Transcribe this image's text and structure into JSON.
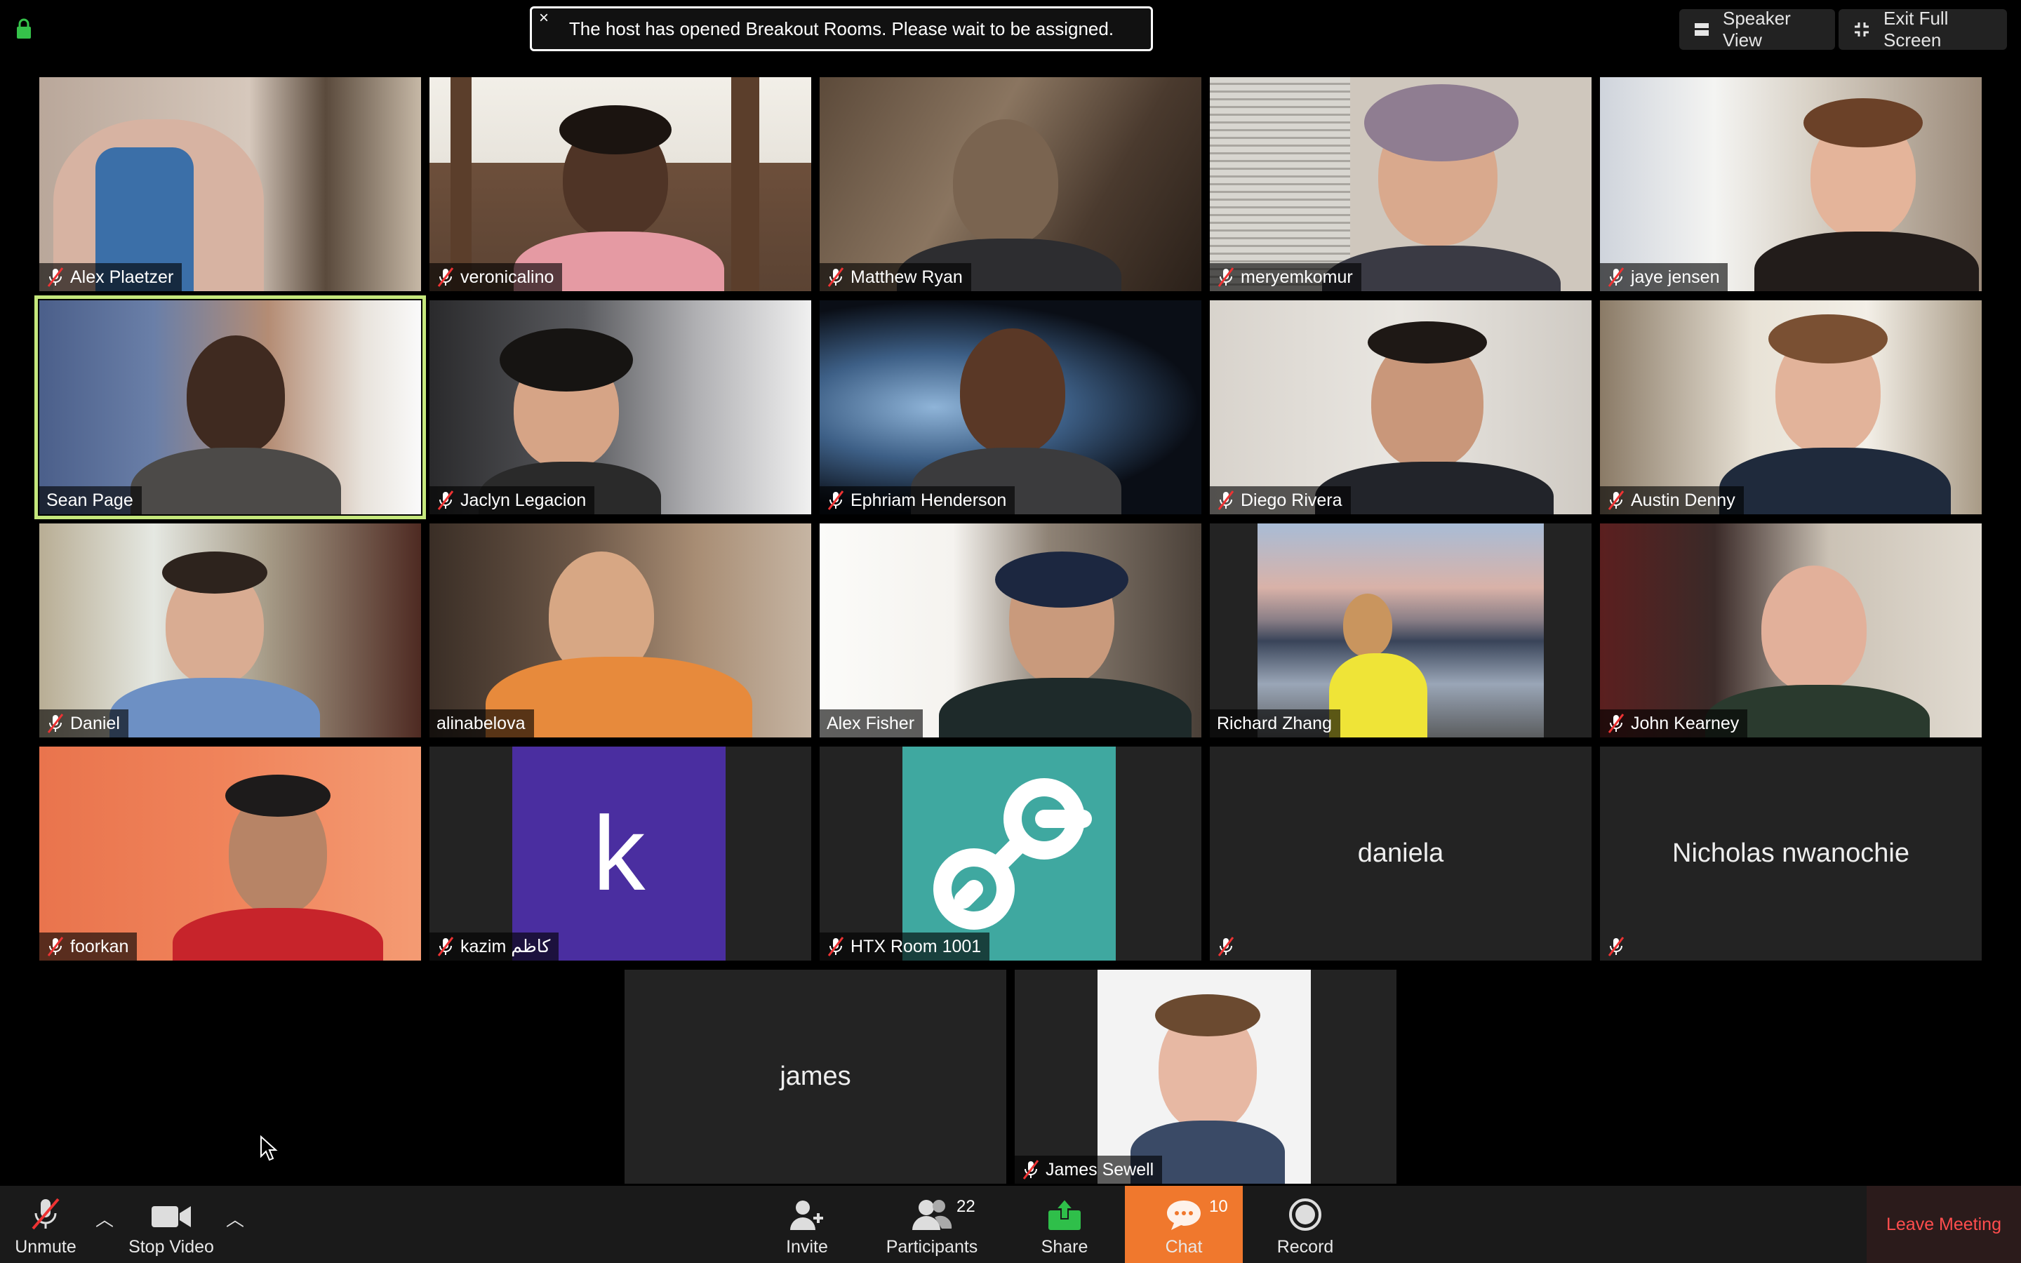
{
  "banner": {
    "text": "The host has opened Breakout Rooms. Please wait to be assigned.",
    "close": "×"
  },
  "top_right": {
    "speaker_view": "Speaker View",
    "exit_full_screen": "Exit Full Screen"
  },
  "participants": [
    {
      "name": "Alex Plaetzer",
      "muted": true
    },
    {
      "name": "veronicalino",
      "muted": true
    },
    {
      "name": "Matthew Ryan",
      "muted": true
    },
    {
      "name": "meryemkomur",
      "muted": true
    },
    {
      "name": "jaye jensen",
      "muted": true
    },
    {
      "name": "Sean Page",
      "muted": false,
      "active_speaker": true
    },
    {
      "name": "Jaclyn Legacion",
      "muted": true
    },
    {
      "name": "Ephriam Henderson",
      "muted": true
    },
    {
      "name": "Diego Rivera",
      "muted": true
    },
    {
      "name": "Austin Denny",
      "muted": true
    },
    {
      "name": "Daniel",
      "muted": true
    },
    {
      "name": "alinabelova",
      "muted": false
    },
    {
      "name": "Alex Fisher",
      "muted": false
    },
    {
      "name": "Richard Zhang",
      "muted": false
    },
    {
      "name": "John Kearney",
      "muted": true
    },
    {
      "name": "foorkan",
      "muted": true
    },
    {
      "name": "kazim كاظم",
      "muted": true,
      "avatar_letter": "k"
    },
    {
      "name": "HTX Room 1001",
      "muted": true
    },
    {
      "name": "daniela",
      "muted": true,
      "video_off": true
    },
    {
      "name": "Nicholas nwanochie",
      "muted": true,
      "video_off": true
    },
    {
      "name": "james",
      "muted": false,
      "video_off": true
    },
    {
      "name": "James Sewell",
      "muted": true
    }
  ],
  "toolbar": {
    "unmute": "Unmute",
    "stop_video": "Stop Video",
    "invite": "Invite",
    "participants": "Participants",
    "participants_count": "22",
    "share": "Share",
    "chat": "Chat",
    "chat_count": "10",
    "record": "Record",
    "leave": "Leave Meeting"
  },
  "colors": {
    "active_speaker_border": "#c5e77c",
    "chat_accent": "#f0782d",
    "leave_text": "#ff4d4d",
    "kazim_avatar": "#4a2ea0",
    "htx_avatar": "#3fa8a0",
    "share_green": "#2fbf4a"
  }
}
